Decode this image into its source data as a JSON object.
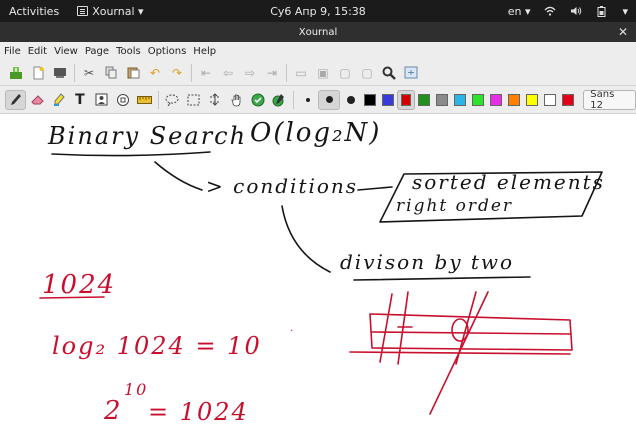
{
  "topbar": {
    "activities": "Activities",
    "app_name": "Xournal ▾",
    "clock": "Су6 Апр 9, 15:38",
    "keyboard_layout": "en ▾"
  },
  "window": {
    "title": "Xournal"
  },
  "menu": [
    "File",
    "Edit",
    "View",
    "Page",
    "Tools",
    "Options",
    "Help"
  ],
  "toolbar": {
    "font_button": "Sans 12",
    "colors": [
      "#000000",
      "#3a3adb",
      "#d40000",
      "#1f8f1f",
      "#8a8a8a",
      "#2bb5e6",
      "#2ee32e",
      "#e62ee6",
      "#ff8000",
      "#ffff00",
      "#ffffff",
      "#e3001b"
    ],
    "selected_color": "#d40000"
  },
  "canvas": {
    "title": "Binary Search",
    "complexity": "O(log₂N)",
    "conditions": "> conditions",
    "sorted": "sorted elements",
    "order": "right order",
    "division": "divison by two",
    "value": "1024",
    "log_equation": "log₂ 1024 = 10",
    "power_base": "2",
    "power_exp": "10",
    "power_rhs": "= 1024",
    "ink_black": "#151515",
    "ink_red": "#c8102e"
  }
}
